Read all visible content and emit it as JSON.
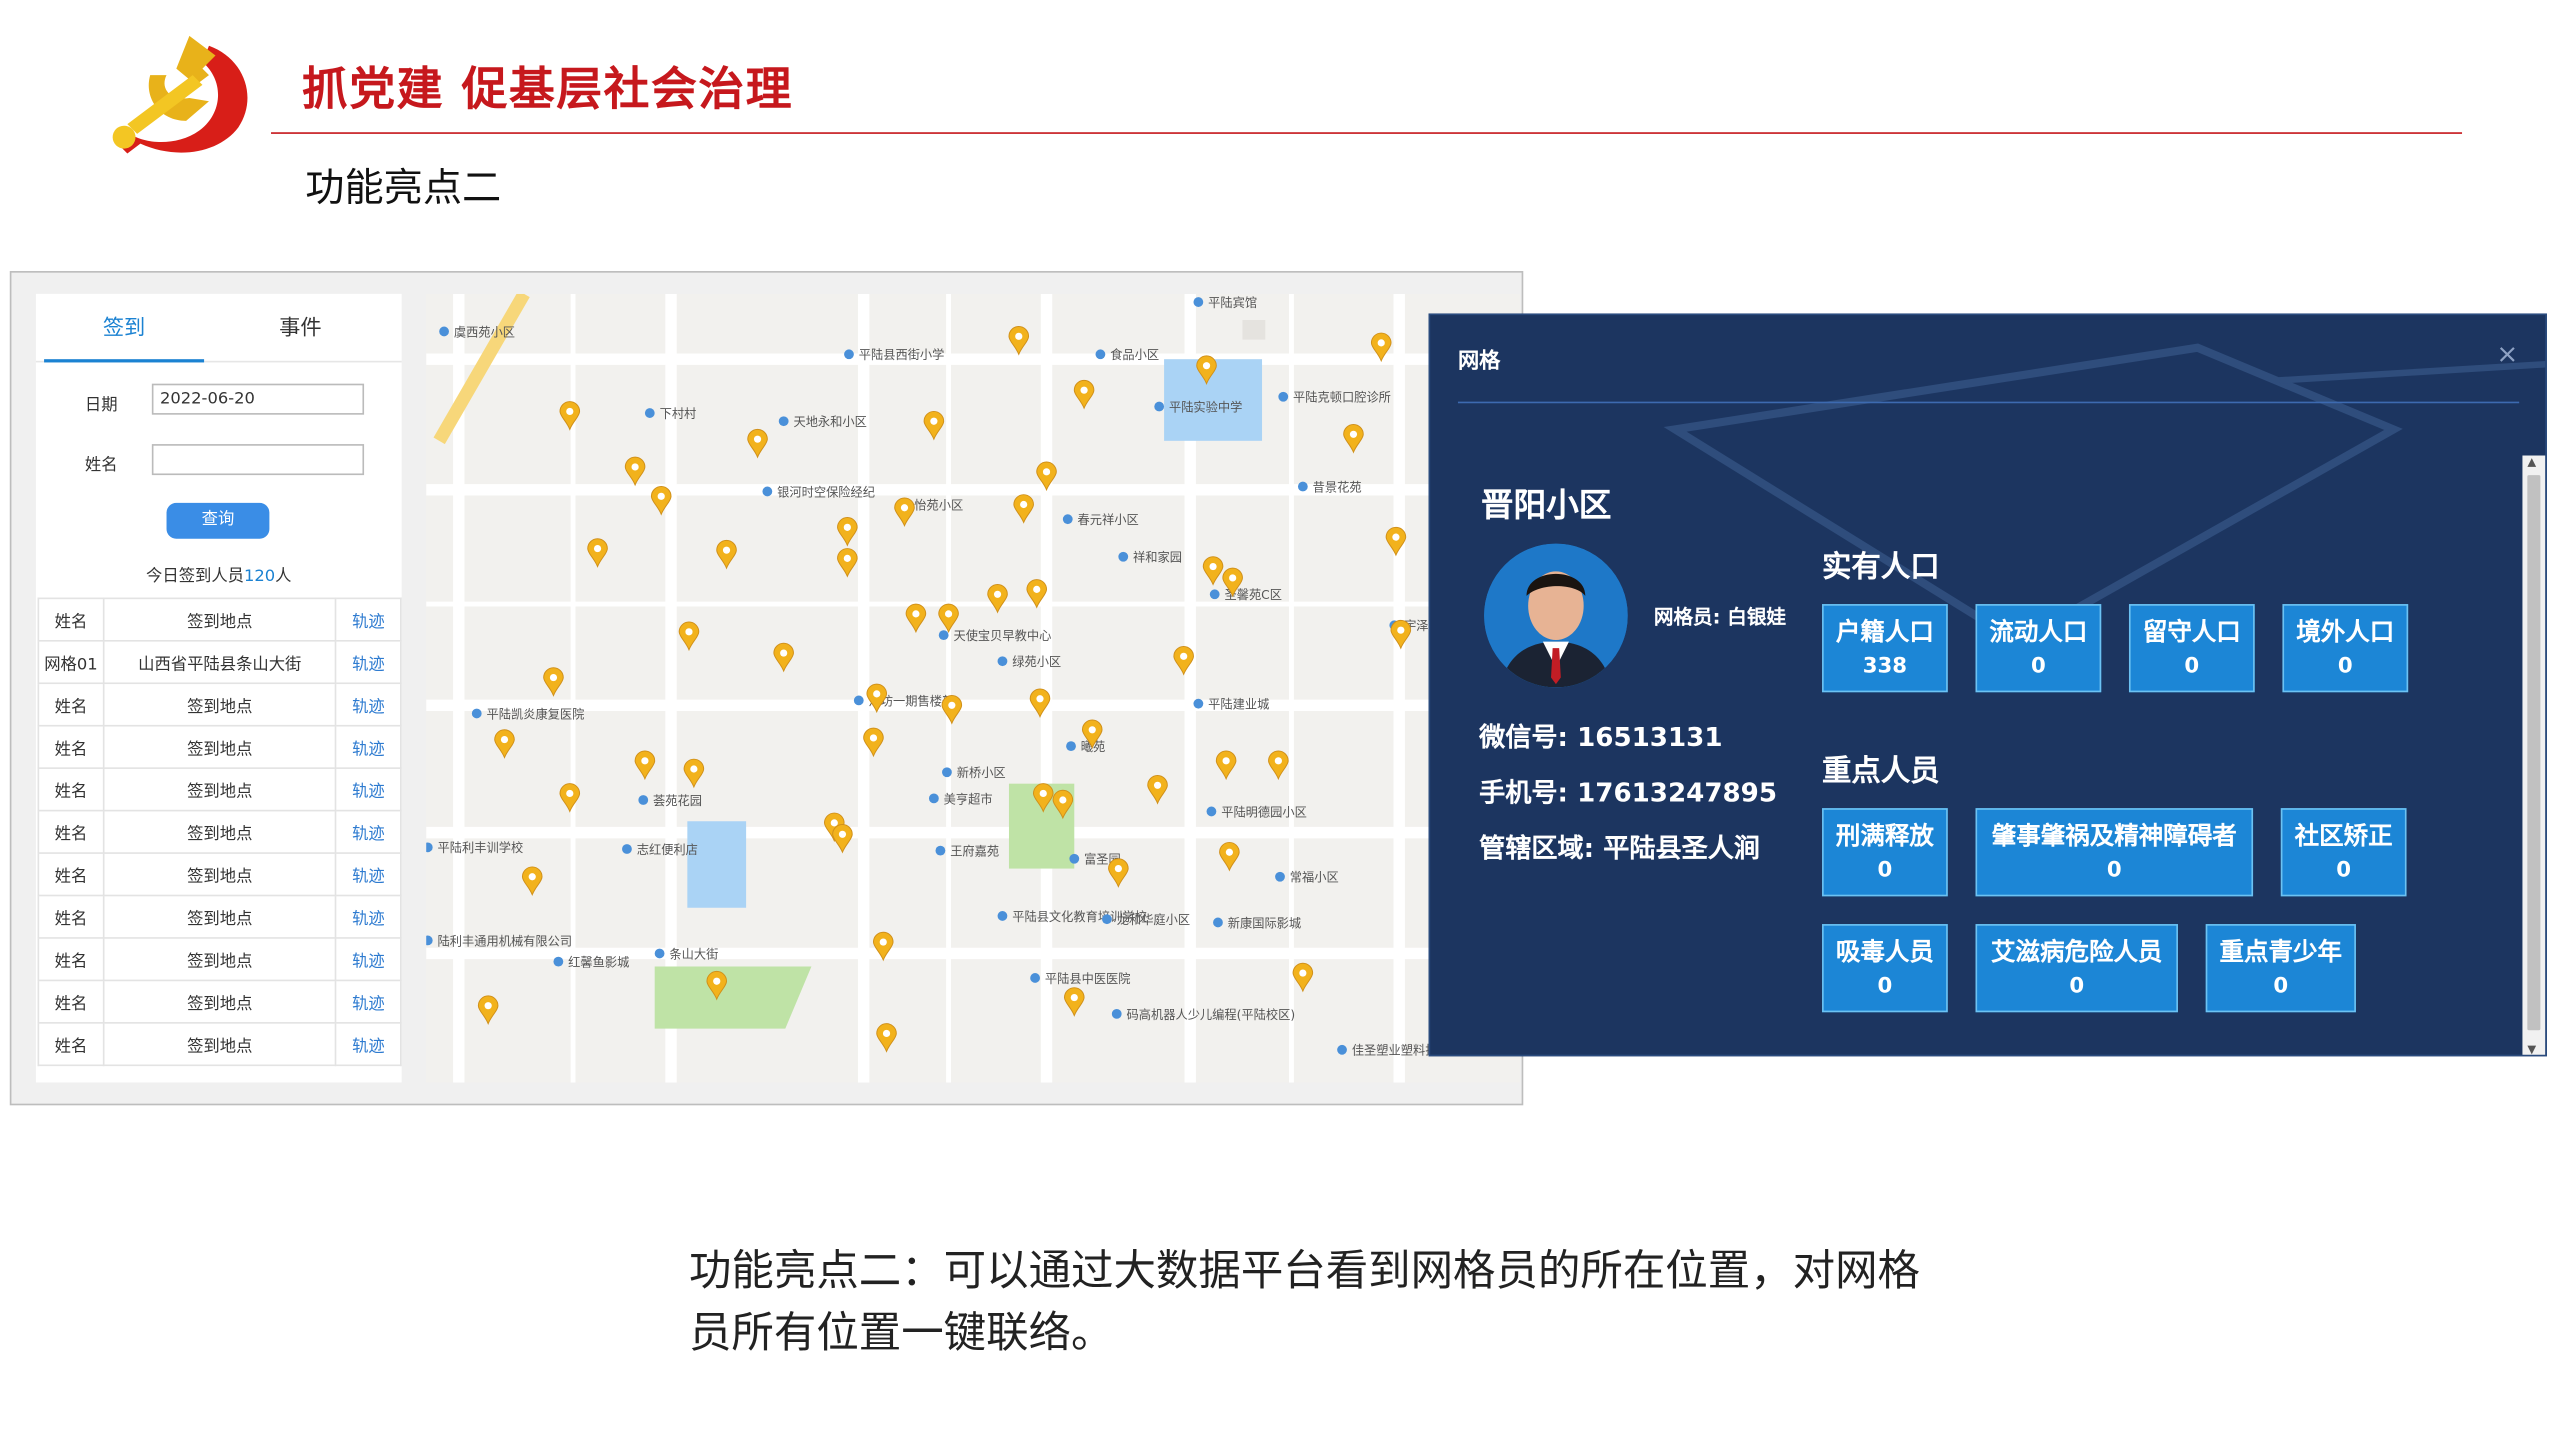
{
  "header": {
    "title": "抓党建 促基层社会治理",
    "subtitle": "功能亮点二"
  },
  "left_panel": {
    "tabs": [
      "签到",
      "事件"
    ],
    "date_label": "日期",
    "date_value": "2022-06-20",
    "name_label": "姓名",
    "name_value": "",
    "query_button": "查询",
    "count_prefix": "今日签到人员",
    "count_value": "120",
    "count_suffix": "人",
    "rows": [
      [
        "姓名",
        "签到地点",
        "轨迹"
      ],
      [
        "网格01",
        "山西省平陆县条山大街",
        "轨迹"
      ],
      [
        "姓名",
        "签到地点",
        "轨迹"
      ],
      [
        "姓名",
        "签到地点",
        "轨迹"
      ],
      [
        "姓名",
        "签到地点",
        "轨迹"
      ],
      [
        "姓名",
        "签到地点",
        "轨迹"
      ],
      [
        "姓名",
        "签到地点",
        "轨迹"
      ],
      [
        "姓名",
        "签到地点",
        "轨迹"
      ],
      [
        "姓名",
        "签到地点",
        "轨迹"
      ],
      [
        "姓名",
        "签到地点",
        "轨迹"
      ],
      [
        "姓名",
        "签到地点",
        "轨迹"
      ]
    ]
  },
  "map": {
    "pin_color": "#f2b21c",
    "labels": [
      "虞西苑小区",
      "平陆县西街小学",
      "食品小区",
      "平陆宾馆",
      "平陆克顿口腔诊所",
      "天地永和小区",
      "平陆实验中学",
      "下村村",
      "银河时空保险经纪",
      "怡苑小区",
      "春元祥小区",
      "昔景花苑",
      "祥和家园",
      "圣馨苑C区",
      "天使宝贝早教中心",
      "绿苑小区",
      "平陆建业城",
      "河坊一期售楼部",
      "平陆凯炎康复医院",
      "曦苑",
      "新桥小区",
      "美亨超市",
      "平陆明德园小区",
      "荟苑花园",
      "平陆利丰训学校",
      "志红便利店",
      "王府嘉苑",
      "富圣园",
      "常福小区",
      "平陆县文化教育培训学校",
      "龙和华庭小区",
      "新康国际影城",
      "条山大街",
      "陆利丰通用机械有限公司",
      "红馨鱼影城",
      "平陆县中医医院",
      "码高机器人少儿编程(平陆校区)",
      "佳圣塑业塑料批发",
      "宇泽"
    ]
  },
  "dialog": {
    "title": "网格",
    "close_symbol": "×",
    "community": "晋阳小区",
    "grid_worker": "网格员: 白银娃",
    "wechat": "微信号: 16513131",
    "phone": "手机号: 17613247895",
    "area": "管辖区域: 平陆县圣人涧",
    "population_title": "实有人口",
    "population": [
      {
        "label": "户籍人口",
        "value": "338"
      },
      {
        "label": "流动人口",
        "value": "0"
      },
      {
        "label": "留守人口",
        "value": "0"
      },
      {
        "label": "境外人口",
        "value": "0"
      }
    ],
    "key_title": "重点人员",
    "key_people": [
      {
        "label": "刑满释放",
        "value": "0"
      },
      {
        "label": "肇事肇祸及精神障碍者",
        "value": "0"
      },
      {
        "label": "社区矫正",
        "value": "0"
      },
      {
        "label": "吸毒人员",
        "value": "0"
      },
      {
        "label": "艾滋病危险人员",
        "value": "0"
      },
      {
        "label": "重点青少年",
        "value": "0"
      }
    ]
  },
  "caption": {
    "line1": "功能亮点二：可以通过大数据平台看到网格员的所在位置，对网格",
    "line2": "员所有位置一键联络。"
  }
}
